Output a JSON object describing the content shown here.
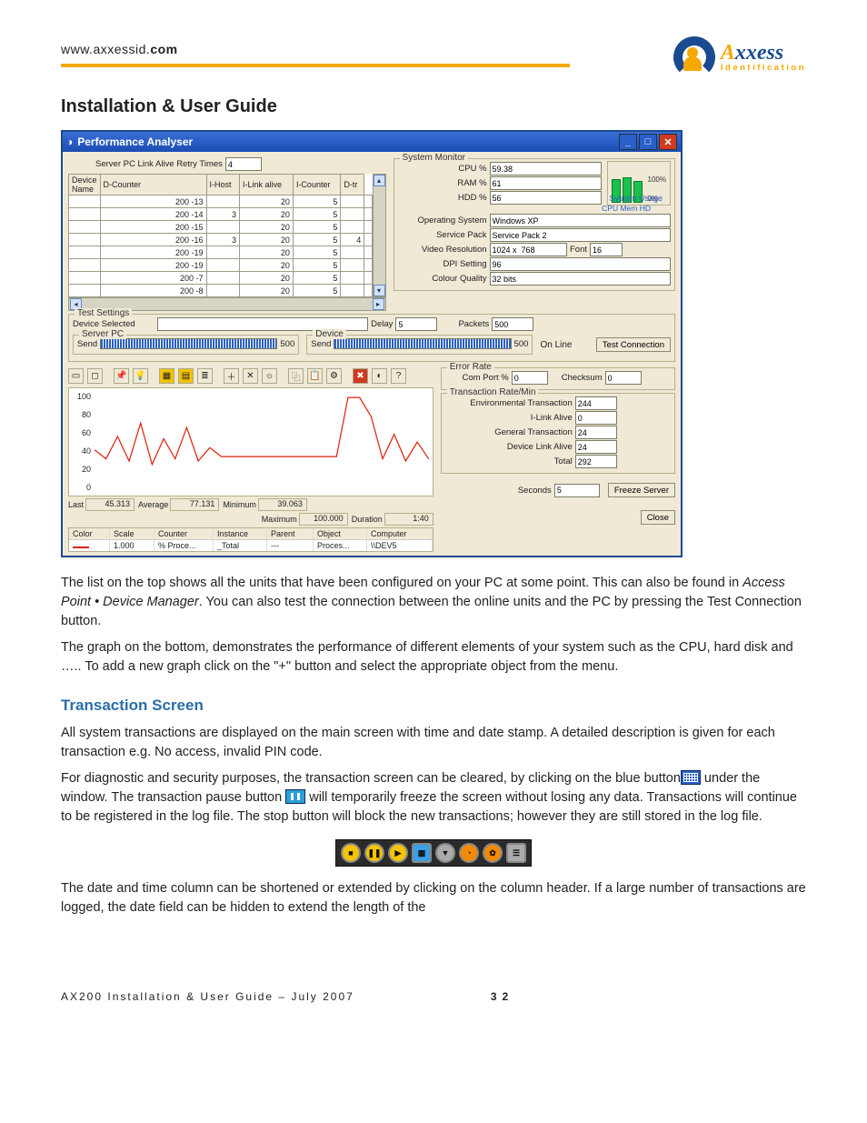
{
  "header": {
    "url_prefix": "www.axxessid.",
    "url_bold": "com",
    "logo_text": "xxess",
    "logo_prefix": "A",
    "logo_sub": "Identification"
  },
  "h1": "Installation & User Guide",
  "win": {
    "title": "Performance Analyser",
    "retry_label": "Server PC Link Alive Retry Times",
    "retry_value": "4",
    "devcols": [
      "Device Name",
      "D-Counter",
      "I-Host",
      "I-Link alive",
      "I-Counter",
      "D-tr"
    ],
    "devrows": [
      {
        "name": "200 -13",
        "dc": "",
        "ih": "20",
        "il": "5",
        "ic": "",
        "dt": ""
      },
      {
        "name": "200 -14",
        "dc": "3",
        "ih": "20",
        "il": "5",
        "ic": "",
        "dt": ""
      },
      {
        "name": "200 -15",
        "dc": "",
        "ih": "20",
        "il": "5",
        "ic": "",
        "dt": ""
      },
      {
        "name": "200 -16",
        "dc": "3",
        "ih": "20",
        "il": "5",
        "ic": "4",
        "dt": ""
      },
      {
        "name": "200 -19",
        "dc": "",
        "ih": "20",
        "il": "5",
        "ic": "",
        "dt": ""
      },
      {
        "name": "200 -19",
        "dc": "",
        "ih": "20",
        "il": "5",
        "ic": "",
        "dt": ""
      },
      {
        "name": "200 -7",
        "dc": "",
        "ih": "20",
        "il": "5",
        "ic": "",
        "dt": ""
      },
      {
        "name": "200 -8",
        "dc": "",
        "ih": "20",
        "il": "5",
        "ic": "",
        "dt": ""
      }
    ],
    "sysmon": {
      "legend": "System Monitor",
      "usage": "System Usage",
      "pct100": "100%",
      "pct0": "0%",
      "usagelbl": "CPU Mem HD",
      "cpu_l": "CPU %",
      "cpu_v": "59.38",
      "ram_l": "RAM %",
      "ram_v": "61",
      "hdd_l": "HDD %",
      "hdd_v": "56",
      "os_l": "Operating System",
      "os_v": "Windows XP",
      "sp_l": "Service Pack",
      "sp_v": "Service Pack 2",
      "vr_l": "Video Resolution",
      "vr_v": "1024 x  768",
      "font_l": "Font",
      "font_v": "16",
      "dpi_l": "DPI Setting",
      "dpi_v": "96",
      "cq_l": "Colour Quality",
      "cq_v": "32 bits"
    },
    "test": {
      "legend": "Test Settings",
      "device_selected": "Device Selected",
      "delay_l": "Delay",
      "delay_v": "5",
      "packets_l": "Packets",
      "packets_v": "500",
      "serverpc": "Server PC",
      "device": "Device",
      "send": "Send",
      "send_v": "500",
      "online": "On Line",
      "testbtn": "Test Connection"
    },
    "err": {
      "legend": "Error Rate",
      "comport_l": "Com Port %",
      "comport_v": "0",
      "checksum_l": "Checksum",
      "checksum_v": "0"
    },
    "trate": {
      "legend": "Transaction Rate/Min",
      "env_l": "Environmental Transaction",
      "env_v": "244",
      "il_l": "I-Link Alive",
      "il_v": "0",
      "gt_l": "General Transaction",
      "gt_v": "24",
      "dla_l": "Device Link Alive",
      "dla_v": "24",
      "total_l": "Total",
      "total_v": "292"
    },
    "bottom": {
      "seconds_l": "Seconds",
      "seconds_v": "5",
      "freeze": "Freeze Server",
      "close": "Close"
    },
    "stats": {
      "last_l": "Last",
      "last_v": "45.313",
      "avg_l": "Average",
      "avg_v": "77.131",
      "min_l": "Minimum",
      "min_v": "39.063",
      "max_l": "Maximum",
      "max_v": "100.000",
      "dur_l": "Duration",
      "dur_v": "1:40"
    },
    "legendtbl": {
      "cols": [
        "Color",
        "Scale",
        "Counter",
        "Instance",
        "Parent",
        "Object",
        "Computer"
      ],
      "row": {
        "scale": "1.000",
        "counter": "% Proce...",
        "instance": "_Total",
        "parent": "---",
        "object": "Proces...",
        "computer": "\\\\DEV5"
      }
    },
    "yticks": [
      "100",
      "80",
      "60",
      "40",
      "20",
      "0"
    ]
  },
  "body": {
    "p1": "The list on the top shows all the units that have been configured on your PC at some point. This can also be found in ",
    "p1i": "Access Point • Device Manager",
    "p1b": ". You can also test the connection between the online units and the PC by pressing the Test Connection button.",
    "p2": "The graph on the bottom, demonstrates the performance of different elements of your system such as the CPU, hard disk and ….. To add a new graph click on the \"+\" button and select the appropriate object from the menu.",
    "h2": "Transaction Screen",
    "p3": "All system transactions are displayed on the main screen with time and date stamp.  A detailed description is given for each transaction e.g. No access, invalid PIN code.",
    "p4a": "For diagnostic and security purposes, the transaction screen can be cleared, by clicking on the blue button",
    "p4b": " under the window. The transaction pause button ",
    "p4c": " will temporarily freeze the screen without losing any data. Transactions will continue to be registered in the log file. The stop button will block the new transactions; however they are still stored in the log file.",
    "p5": "The date and time column can be shortened or extended by clicking on the column header. If a large number of transactions are logged, the date field can be hidden to extend the length of the"
  },
  "chart_data": {
    "type": "line",
    "title": "",
    "xlabel": "",
    "ylabel": "",
    "ylim": [
      0,
      100
    ],
    "series": [
      {
        "name": "% Processor Time",
        "color": "#d21",
        "values": [
          48,
          40,
          60,
          38,
          72,
          35,
          58,
          40,
          68,
          38,
          50,
          42,
          42,
          42,
          42,
          42,
          42,
          42,
          42,
          42,
          42,
          42,
          95,
          95,
          78,
          40,
          62,
          38,
          55,
          40
        ]
      }
    ],
    "stats": {
      "last": 45.313,
      "average": 77.131,
      "minimum": 39.063,
      "maximum": 100.0,
      "duration": "1:40"
    }
  },
  "footer": {
    "left": "AX200 Installation & User Guide – July 2007",
    "page": "32"
  }
}
